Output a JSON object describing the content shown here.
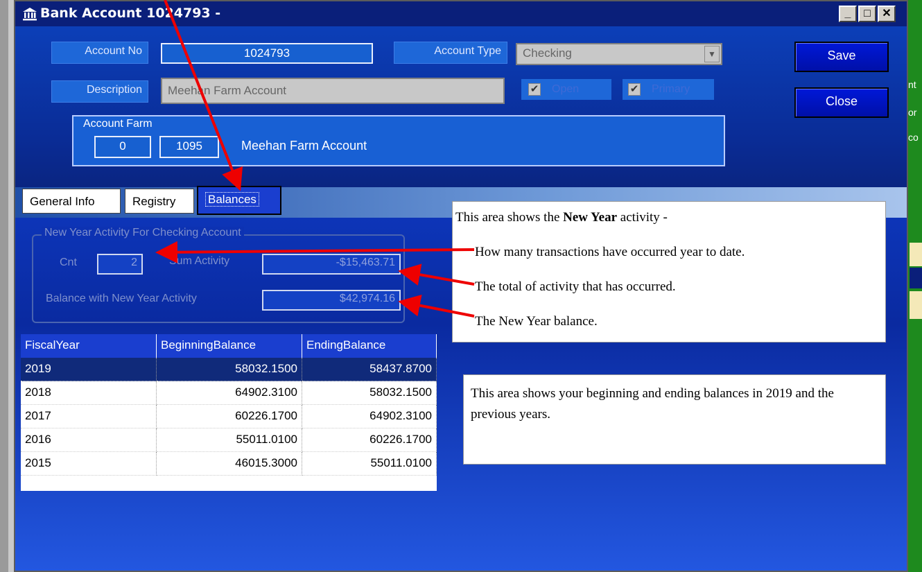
{
  "window": {
    "title": "Bank Account 1024793 -",
    "buttons": {
      "minimize": "_",
      "maximize": "□",
      "close": "✕"
    }
  },
  "header": {
    "account_no_label": "Account No",
    "account_no": "1024793",
    "account_type_label": "Account Type",
    "account_type": "Checking",
    "description_label": "Description",
    "description": "Meehan Farm Account",
    "open_label": "Open",
    "primary_label": "Primary",
    "save_label": "Save",
    "close_label": "Close",
    "farm_legend": "Account Farm",
    "farm_id": "0",
    "farm_code": "1095",
    "farm_name": "Meehan Farm Account"
  },
  "tabs": [
    "General Info",
    "Registry",
    "Balances"
  ],
  "new_year": {
    "legend": "New Year Activity For Checking Account",
    "cnt_label": "Cnt",
    "cnt": "2",
    "sum_label": "Sum Activity",
    "sum": "-$15,463.71",
    "balance_label": "Balance with New Year Activity",
    "balance": "$42,974.16"
  },
  "grid": {
    "columns": [
      "FiscalYear",
      "BeginningBalance",
      "EndingBalance"
    ],
    "rows": [
      [
        "2019",
        "58032.1500",
        "58437.8700"
      ],
      [
        "2018",
        "64902.3100",
        "58032.1500"
      ],
      [
        "2017",
        "60226.1700",
        "64902.3100"
      ],
      [
        "2016",
        "55011.0100",
        "60226.1700"
      ],
      [
        "2015",
        "46015.3000",
        "55011.0100"
      ]
    ]
  },
  "annotations": {
    "ny_prefix": "This area shows the ",
    "ny_bold": "New Year",
    "ny_suffix": " activity -",
    "ny_line1": "How many transactions have occurred year to date.",
    "ny_line2": "The total of activity that has occurred.",
    "ny_line3": "The New Year balance.",
    "balances_note": "This area shows your beginning and ending balances in 2019 and the previous years."
  },
  "right_strip": [
    "nt",
    "or",
    "co"
  ],
  "colors": {
    "arrow": "#ee0000",
    "window_blue": "#0a2a8a",
    "header_button": "#0018d8"
  }
}
